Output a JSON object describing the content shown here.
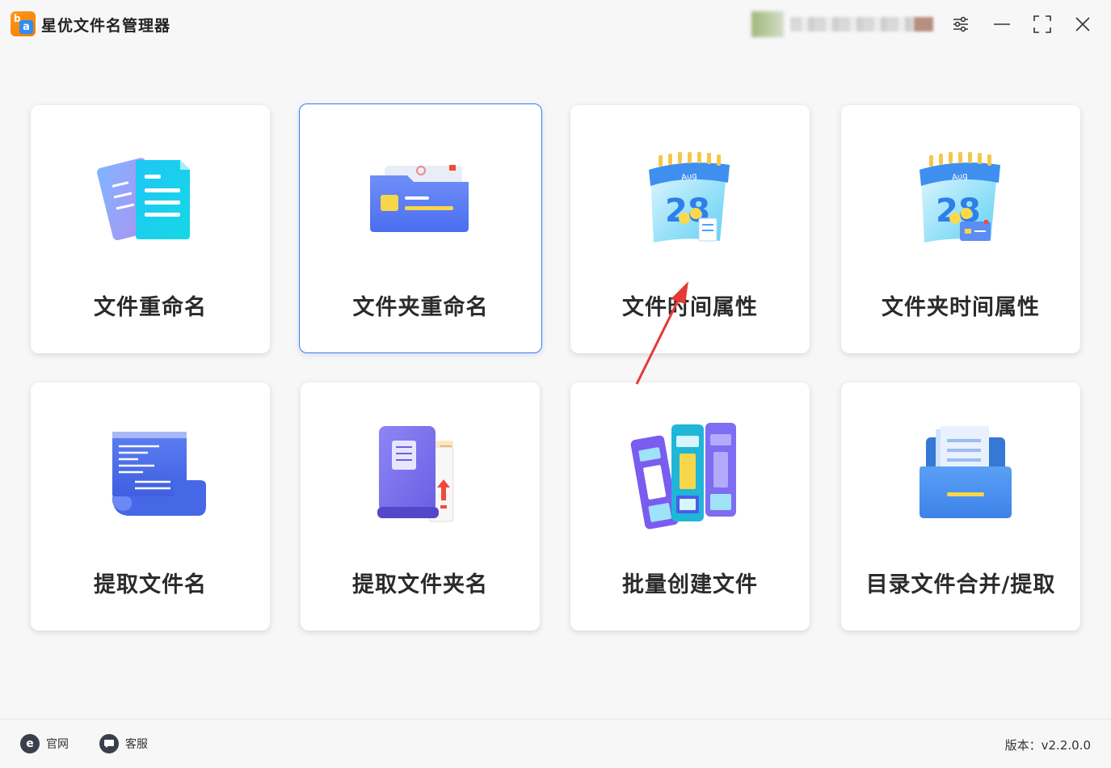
{
  "app": {
    "title": "星优文件名管理器",
    "logo_letter": "a",
    "logo_b": "b"
  },
  "titlebar": {
    "settings_icon": "sliders-icon",
    "minimize_icon": "minimize-icon",
    "maximize_icon": "maximize-icon",
    "close_icon": "close-icon"
  },
  "cards": [
    {
      "label": "文件重命名",
      "icon": "file-rename-icon"
    },
    {
      "label": "文件夹重命名",
      "icon": "folder-rename-icon"
    },
    {
      "label": "文件时间属性",
      "icon": "calendar-icon",
      "calendar_month": "Aug",
      "calendar_day": "28"
    },
    {
      "label": "文件夹时间属性",
      "icon": "calendar-folder-icon",
      "calendar_month": "Aug",
      "calendar_day": "28"
    },
    {
      "label": "提取文件名",
      "icon": "document-scroll-icon"
    },
    {
      "label": "提取文件夹名",
      "icon": "folder-extract-icon"
    },
    {
      "label": "批量创建文件",
      "icon": "binders-icon"
    },
    {
      "label": "目录文件合并/提取",
      "icon": "drawer-folder-icon"
    }
  ],
  "footer": {
    "website_label": "官网",
    "website_icon_letter": "e",
    "support_label": "客服",
    "version_text": "版本：v2.2.0.0"
  },
  "colors": {
    "accent": "#3a7cf0",
    "arrow": "#e53935",
    "logo_orange": "#f58a0d"
  }
}
